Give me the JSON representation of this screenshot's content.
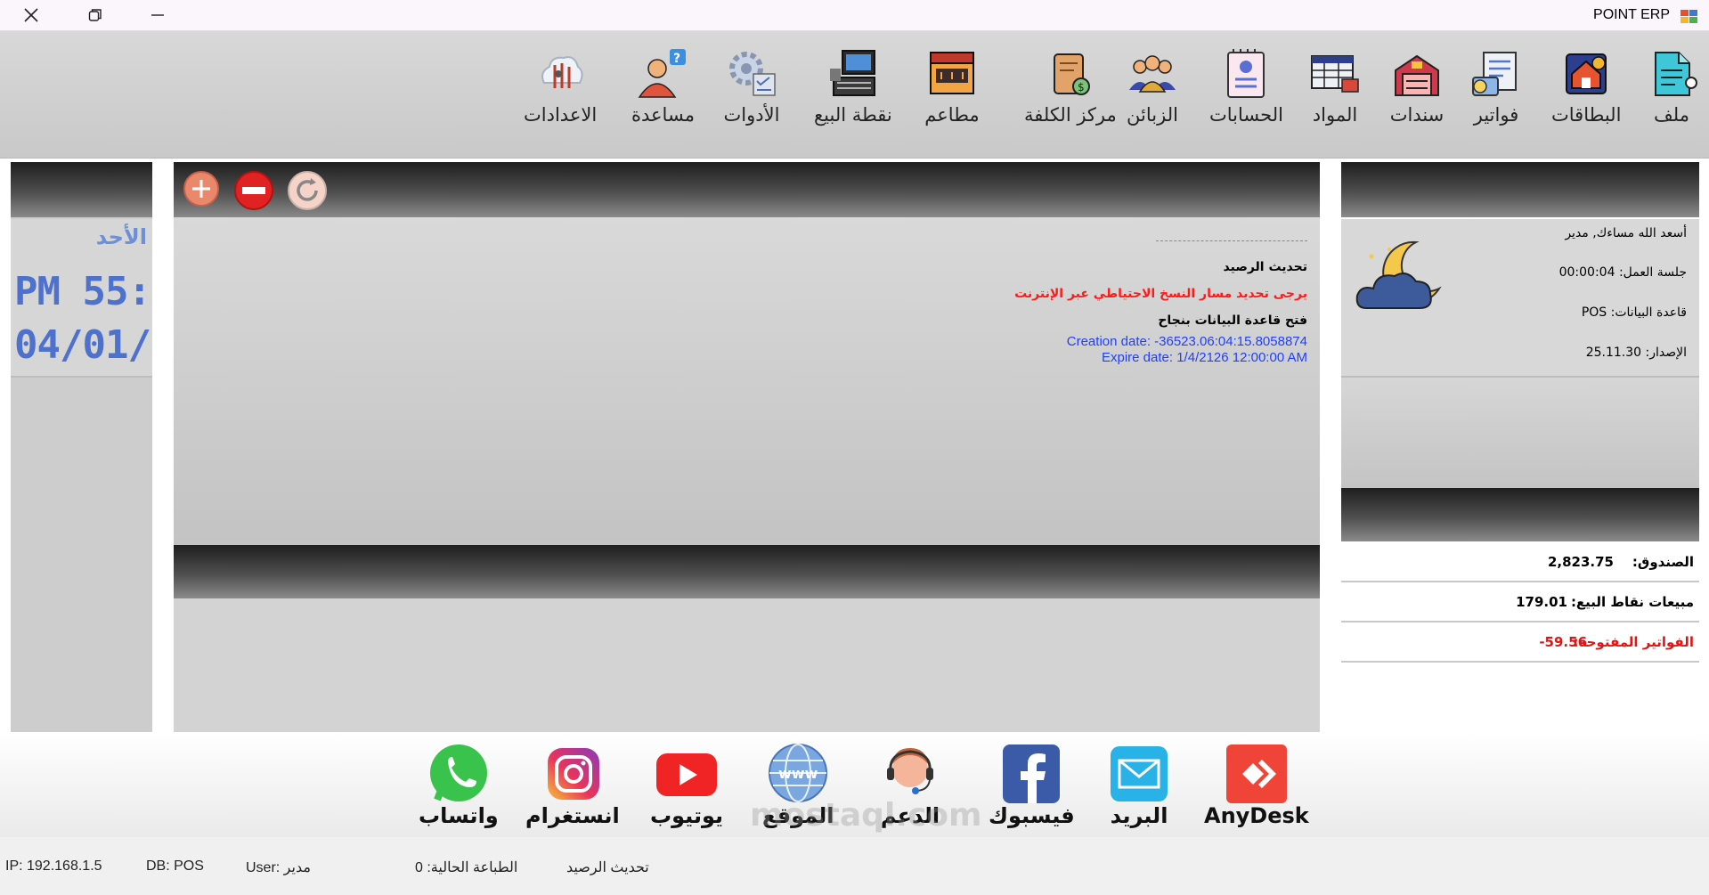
{
  "window": {
    "title": "POINT ERP",
    "close_icon": "close-icon",
    "restore_icon": "restore-icon",
    "minimize_icon": "minimize-icon"
  },
  "toolbar": {
    "items": [
      {
        "label": "ملف",
        "icon": "file-icon"
      },
      {
        "label": "البطاقات",
        "icon": "cards-icon"
      },
      {
        "label": "فواتير",
        "icon": "invoices-icon"
      },
      {
        "label": "سندات",
        "icon": "vouchers-icon"
      },
      {
        "label": "المواد",
        "icon": "items-icon"
      },
      {
        "label": "الحسابات",
        "icon": "accounts-icon"
      },
      {
        "label": "الزبائن",
        "icon": "customers-icon"
      },
      {
        "label": "مركز الكلفة",
        "icon": "cost-center-icon"
      },
      {
        "label": "مطاعم",
        "icon": "restaurant-icon"
      },
      {
        "label": "نقطة البيع",
        "icon": "pos-icon"
      },
      {
        "label": "الأدوات",
        "icon": "tools-icon"
      },
      {
        "label": "مساعدة",
        "icon": "help-icon"
      },
      {
        "label": "الاعدادات",
        "icon": "settings-icon"
      }
    ]
  },
  "left_panel": {
    "day": "الأحد",
    "time": "PM 55:",
    "date": "04/01/"
  },
  "center": {
    "controls": [
      "add-icon",
      "remove-icon",
      "refresh-icon"
    ],
    "log": {
      "line1": "تحديث الرصيد",
      "line2": "يرجى تحديد مسار النسخ الاحتياطي عبر الإنترنت",
      "line3": "فتح قاعدة البيانات بنجاح",
      "creation": "Creation date: -36523.06:04:15.8058874",
      "expire": "Expire date: 1/4/2126 12:00:00 AM"
    },
    "colors": {
      "warning": "#ff1a1a",
      "info": "#1f3fff"
    }
  },
  "right_panel": {
    "greeting": "أسعد الله مساءك, مدير",
    "session_label": "جلسة العمل:",
    "session_value": "00:00:04",
    "db_label": "قاعدة البيانات:",
    "db_value": "POS",
    "version_label": "الإصدار:",
    "version_value": "25.11.30",
    "weather_icon": "moon-cloud-icon",
    "cashbox_label": "الصندوق:",
    "cashbox_value": "2,823.75",
    "pos_sales_label": "مبيعات نقاط البيع:",
    "pos_sales_value": "179.01",
    "open_invoices_label": "الفواتير المفتوحة:",
    "open_invoices_value": "-59.56"
  },
  "social": [
    {
      "label": "واتساب",
      "icon": "whatsapp-icon"
    },
    {
      "label": "انستغرام",
      "icon": "instagram-icon"
    },
    {
      "label": "يوتيوب",
      "icon": "youtube-icon"
    },
    {
      "label": "الموقع",
      "icon": "website-icon"
    },
    {
      "label": "الدعم",
      "icon": "support-icon"
    },
    {
      "label": "فيسبوك",
      "icon": "facebook-icon"
    },
    {
      "label": "البريد",
      "icon": "mail-icon"
    },
    {
      "label": "AnyDesk",
      "icon": "anydesk-icon"
    }
  ],
  "status": {
    "ip": "IP: 192.168.1.5",
    "db": "DB: POS",
    "user": "User: مدير",
    "printer": "الطباعة الحالية: 0",
    "refresh": "تحديث الرصيد"
  },
  "watermark": "mostaql.com"
}
